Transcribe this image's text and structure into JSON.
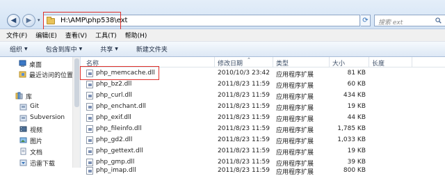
{
  "address": {
    "path": "H:\\AMP\\php538\\ext",
    "dropdown_glyph": "▾"
  },
  "search": {
    "placeholder": "搜索 ext"
  },
  "menu": [
    {
      "label": "文件(F)"
    },
    {
      "label": "编辑(E)"
    },
    {
      "label": "查看(V)"
    },
    {
      "label": "工具(T)"
    },
    {
      "label": "帮助(H)"
    }
  ],
  "commands": [
    {
      "label": "组织",
      "arrow": "▼"
    },
    {
      "label": "包含到库中",
      "arrow": "▼"
    },
    {
      "label": "共享",
      "arrow": "▼"
    },
    {
      "label": "新建文件夹",
      "arrow": ""
    }
  ],
  "nav": {
    "desktop": "桌面",
    "recent": "最近访问的位置",
    "library": "库",
    "git": "Git",
    "subversion": "Subversion",
    "videos": "视频",
    "pictures": "图片",
    "documents": "文档",
    "xunlei": "迅雷下载"
  },
  "columns": {
    "name": "名称",
    "date": "修改日期",
    "type": "类型",
    "size": "大小",
    "length": "长度"
  },
  "files": [
    {
      "name": "php_memcache.dll",
      "date": "2010/10/3 23:42",
      "type": "应用程序扩展",
      "size": "81 KB"
    },
    {
      "name": "php_bz2.dll",
      "date": "2011/8/23 11:59",
      "type": "应用程序扩展",
      "size": "60 KB"
    },
    {
      "name": "php_curl.dll",
      "date": "2011/8/23 11:59",
      "type": "应用程序扩展",
      "size": "434 KB"
    },
    {
      "name": "php_enchant.dll",
      "date": "2011/8/23 11:59",
      "type": "应用程序扩展",
      "size": "19 KB"
    },
    {
      "name": "php_exif.dll",
      "date": "2011/8/23 11:59",
      "type": "应用程序扩展",
      "size": "44 KB"
    },
    {
      "name": "php_fileinfo.dll",
      "date": "2011/8/23 11:59",
      "type": "应用程序扩展",
      "size": "1,785 KB"
    },
    {
      "name": "php_gd2.dll",
      "date": "2011/8/23 11:59",
      "type": "应用程序扩展",
      "size": "1,033 KB"
    },
    {
      "name": "php_gettext.dll",
      "date": "2011/8/23 11:59",
      "type": "应用程序扩展",
      "size": "19 KB"
    },
    {
      "name": "php_gmp.dll",
      "date": "2011/8/23 11:59",
      "type": "应用程序扩展",
      "size": "39 KB"
    },
    {
      "name": "php_imap.dll",
      "date": "2011/8/23 11:59",
      "type": "应用程序扩展",
      "size": "800 KB"
    }
  ],
  "colors": {
    "highlight_box": "#e0302a",
    "folder": "#e8c35a",
    "toolbar_bg": "#dde8f5"
  }
}
